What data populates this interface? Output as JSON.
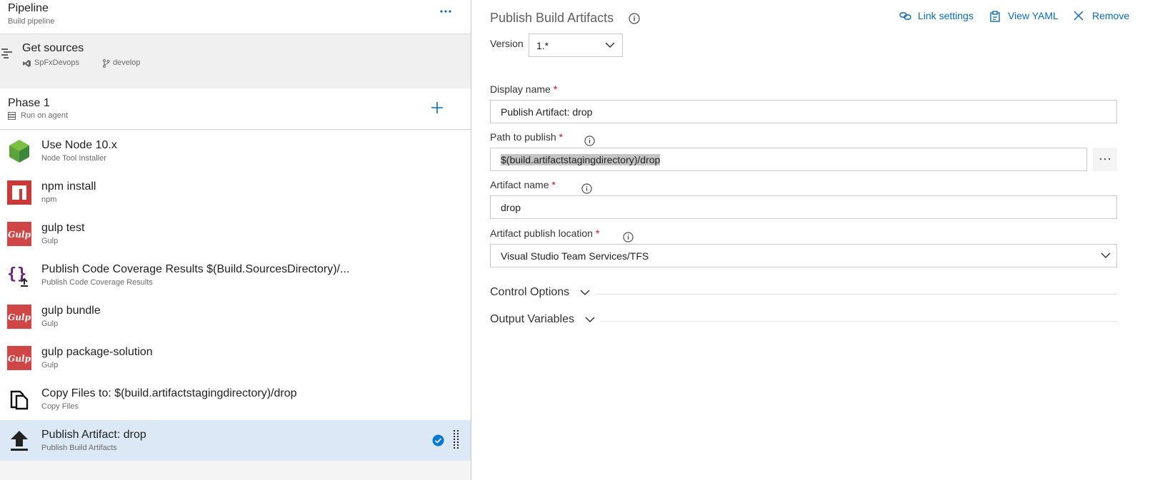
{
  "pipeline": {
    "title": "Pipeline",
    "subtitle": "Build pipeline"
  },
  "sources": {
    "title": "Get sources",
    "repo": "SpFxDevops",
    "branch": "develop"
  },
  "phase": {
    "title": "Phase 1",
    "subtitle": "Run on agent"
  },
  "tasks": [
    {
      "name": "Use Node 10.x",
      "type": "Node Tool Installer",
      "icon": "node-icon"
    },
    {
      "name": "npm install",
      "type": "npm",
      "icon": "npm-icon"
    },
    {
      "name": "gulp test",
      "type": "Gulp",
      "icon": "gulp-icon"
    },
    {
      "name": "Publish Code Coverage Results $(Build.SourcesDirectory)/...",
      "type": "Publish Code Coverage Results",
      "icon": "code-coverage-icon"
    },
    {
      "name": "gulp bundle",
      "type": "Gulp",
      "icon": "gulp-icon"
    },
    {
      "name": "gulp package-solution",
      "type": "Gulp",
      "icon": "gulp-icon"
    },
    {
      "name": "Copy Files to: $(build.artifactstagingdirectory)/drop",
      "type": "Copy Files",
      "icon": "copy-files-icon"
    },
    {
      "name": "Publish Artifact: drop",
      "type": "Publish Build Artifacts",
      "icon": "publish-artifact-icon",
      "selected": true
    }
  ],
  "details": {
    "title": "Publish Build Artifacts",
    "link_settings": "Link settings",
    "view_yaml": "View YAML",
    "remove": "Remove",
    "version_label": "Version",
    "version_value": "1.*",
    "display_name_label": "Display name",
    "display_name_value": "Publish Artifact:  drop",
    "path_label": "Path to publish",
    "path_value": "$(build.artifactstagingdirectory)/drop",
    "artifact_name_label": "Artifact name",
    "artifact_name_value": "drop",
    "location_label": "Artifact publish location",
    "location_value": "Visual Studio Team Services/TFS",
    "required_marker": "*",
    "control_options": "Control Options",
    "output_variables": "Output Variables"
  },
  "colors": {
    "accent": "#0a6ab8",
    "required": "#c8102e",
    "selected_row": "#dce8f6",
    "check": "#0078d4",
    "gulp": "#cf4647",
    "npm": "#cb3837",
    "node": "#3c873a"
  }
}
